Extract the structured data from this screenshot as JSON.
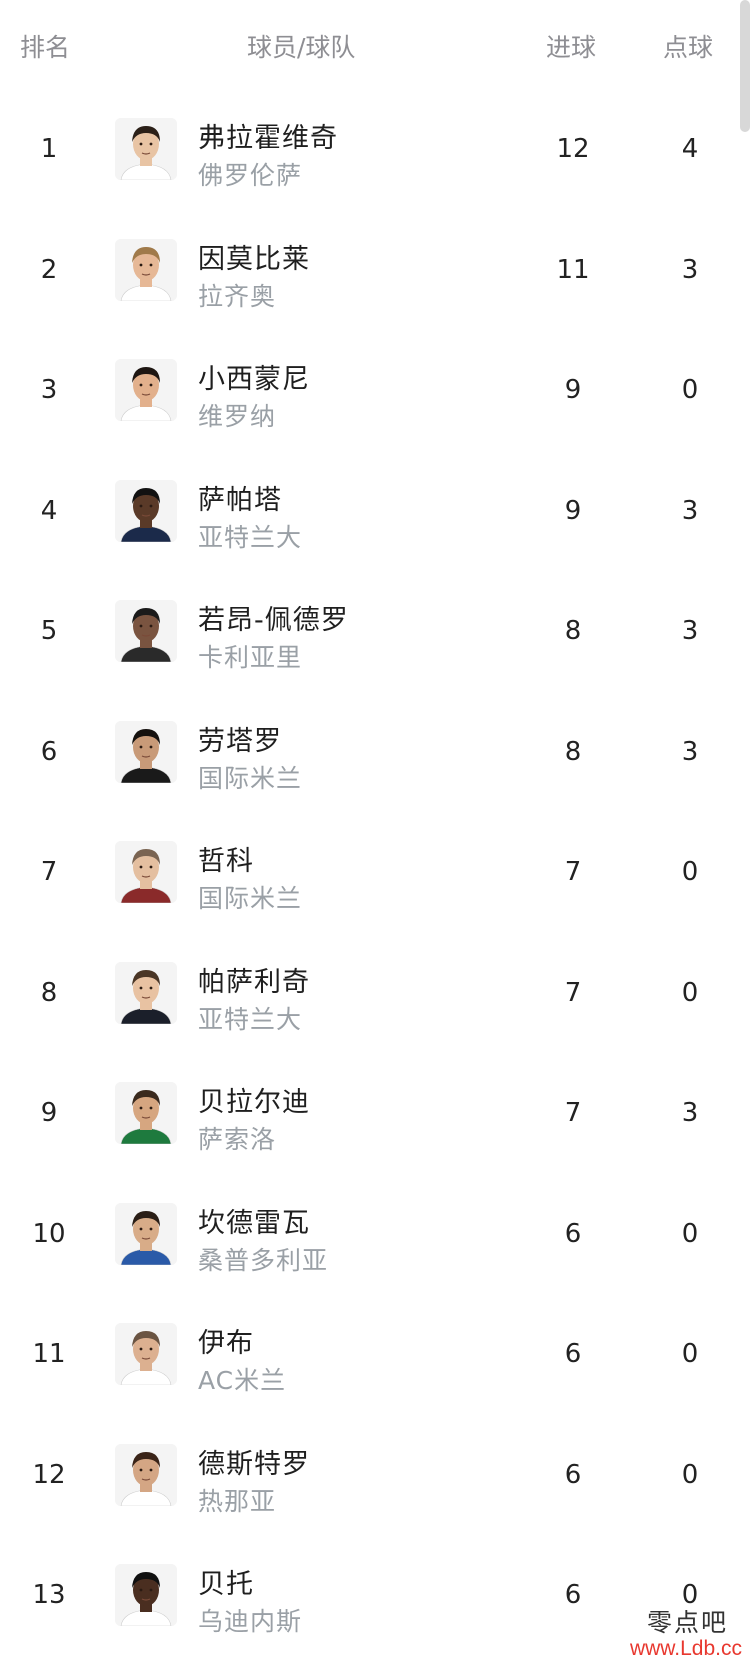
{
  "header": {
    "rank": "排名",
    "player_team": "球员/球队",
    "goals": "进球",
    "penalties": "点球"
  },
  "rows": [
    {
      "rank": "1",
      "name": "弗拉霍维奇",
      "team": "佛罗伦萨",
      "goals": "12",
      "penalties": "4",
      "skin": "#e8c4a4",
      "hair": "#2b2018",
      "shirt": "#ffffff"
    },
    {
      "rank": "2",
      "name": "因莫比莱",
      "team": "拉齐奥",
      "goals": "11",
      "penalties": "3",
      "skin": "#e6b896",
      "hair": "#a07a4a",
      "shirt": "#ffffff"
    },
    {
      "rank": "3",
      "name": "小西蒙尼",
      "team": "维罗纳",
      "goals": "9",
      "penalties": "0",
      "skin": "#e2b08c",
      "hair": "#1e1612",
      "shirt": "#ffffff"
    },
    {
      "rank": "4",
      "name": "萨帕塔",
      "team": "亚特兰大",
      "goals": "9",
      "penalties": "3",
      "skin": "#5a3a28",
      "hair": "#111111",
      "shirt": "#1b2a4a"
    },
    {
      "rank": "5",
      "name": "若昂-佩德罗",
      "team": "卡利亚里",
      "goals": "8",
      "penalties": "3",
      "skin": "#7a5440",
      "hair": "#1a1a1a",
      "shirt": "#2a2a2a"
    },
    {
      "rank": "6",
      "name": "劳塔罗",
      "team": "国际米兰",
      "goals": "8",
      "penalties": "3",
      "skin": "#c89a78",
      "hair": "#15110e",
      "shirt": "#1a1a1a"
    },
    {
      "rank": "7",
      "name": "哲科",
      "team": "国际米兰",
      "goals": "7",
      "penalties": "0",
      "skin": "#e4bfa0",
      "hair": "#7a6452",
      "shirt": "#8a2a2a"
    },
    {
      "rank": "8",
      "name": "帕萨利奇",
      "team": "亚特兰大",
      "goals": "7",
      "penalties": "0",
      "skin": "#e8c2a2",
      "hair": "#4a3626",
      "shirt": "#1b1f2a"
    },
    {
      "rank": "9",
      "name": "贝拉尔迪",
      "team": "萨索洛",
      "goals": "7",
      "penalties": "3",
      "skin": "#d6a680",
      "hair": "#3a2a1e",
      "shirt": "#1e7a3e"
    },
    {
      "rank": "10",
      "name": "坎德雷瓦",
      "team": "桑普多利亚",
      "goals": "6",
      "penalties": "0",
      "skin": "#d8ac88",
      "hair": "#2a1e16",
      "shirt": "#2a5aa8"
    },
    {
      "rank": "11",
      "name": "伊布",
      "team": "AC米兰",
      "goals": "6",
      "penalties": "0",
      "skin": "#dcb090",
      "hair": "#6a5442",
      "shirt": "#ffffff"
    },
    {
      "rank": "12",
      "name": "德斯特罗",
      "team": "热那亚",
      "goals": "6",
      "penalties": "0",
      "skin": "#d4a684",
      "hair": "#3a2418",
      "shirt": "#ffffff"
    },
    {
      "rank": "13",
      "name": "贝托",
      "team": "乌迪内斯",
      "goals": "6",
      "penalties": "0",
      "skin": "#4a2e20",
      "hair": "#101010",
      "shirt": "#ffffff"
    }
  ],
  "watermark": {
    "name": "零点吧",
    "url": "www.Ldb.cc"
  }
}
